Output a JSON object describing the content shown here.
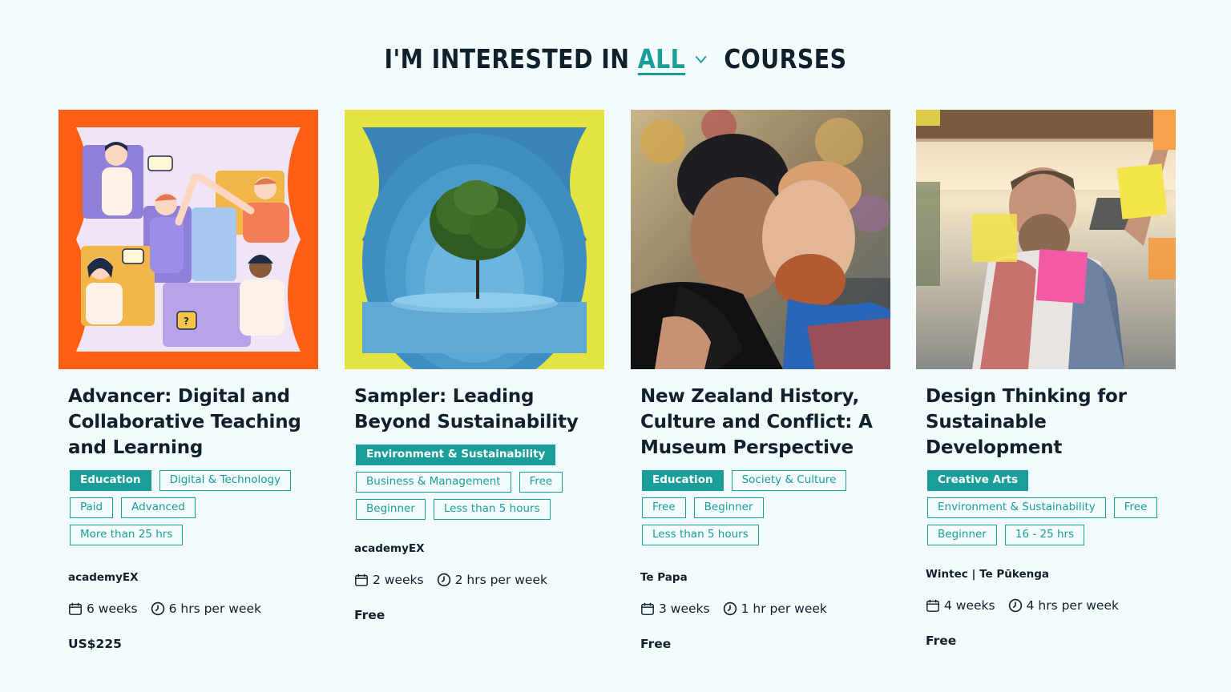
{
  "heading": {
    "prefix": "I'M INTERESTED IN",
    "filter": "ALL",
    "suffix": "COURSES"
  },
  "colors": {
    "accent": "#1a9e9a",
    "text": "#10202c",
    "background": "#f3fbfc"
  },
  "courses": [
    {
      "title": "Advancer: Digital and Collaborative Teaching and Learning",
      "image": "illustration-video-call",
      "primary_tag": "Education",
      "tags": [
        "Digital & Technology",
        "Paid",
        "Advanced",
        "More than 25 hrs"
      ],
      "provider": "academyEX",
      "duration": "6 weeks",
      "effort": "6 hrs per week",
      "price": "US$225"
    },
    {
      "title": "Sampler: Leading Beyond Sustainability",
      "image": "tree-in-arches",
      "primary_tag": "Environment & Sustainability",
      "tags": [
        "Business & Management",
        "Free",
        "Beginner",
        "Less than 5 hours"
      ],
      "provider": "academyEX",
      "duration": "2 weeks",
      "effort": "2 hrs per week",
      "price": "Free"
    },
    {
      "title": "New Zealand History, Culture and Conflict: A Museum Perspective",
      "image": "hongi-photo",
      "primary_tag": "Education",
      "tags": [
        "Society & Culture",
        "Free",
        "Beginner",
        "Less than 5 hours"
      ],
      "provider": "Te Papa",
      "duration": "3 weeks",
      "effort": "1 hr per week",
      "price": "Free"
    },
    {
      "title": "Design Thinking for Sustainable Development",
      "image": "sticky-notes-photo",
      "primary_tag": "Creative Arts",
      "tags": [
        "Environment & Sustainability",
        "Free",
        "Beginner",
        "16 - 25 hrs"
      ],
      "provider": "Wintec | Te Pūkenga",
      "duration": "4 weeks",
      "effort": "4 hrs per week",
      "price": "Free"
    }
  ]
}
